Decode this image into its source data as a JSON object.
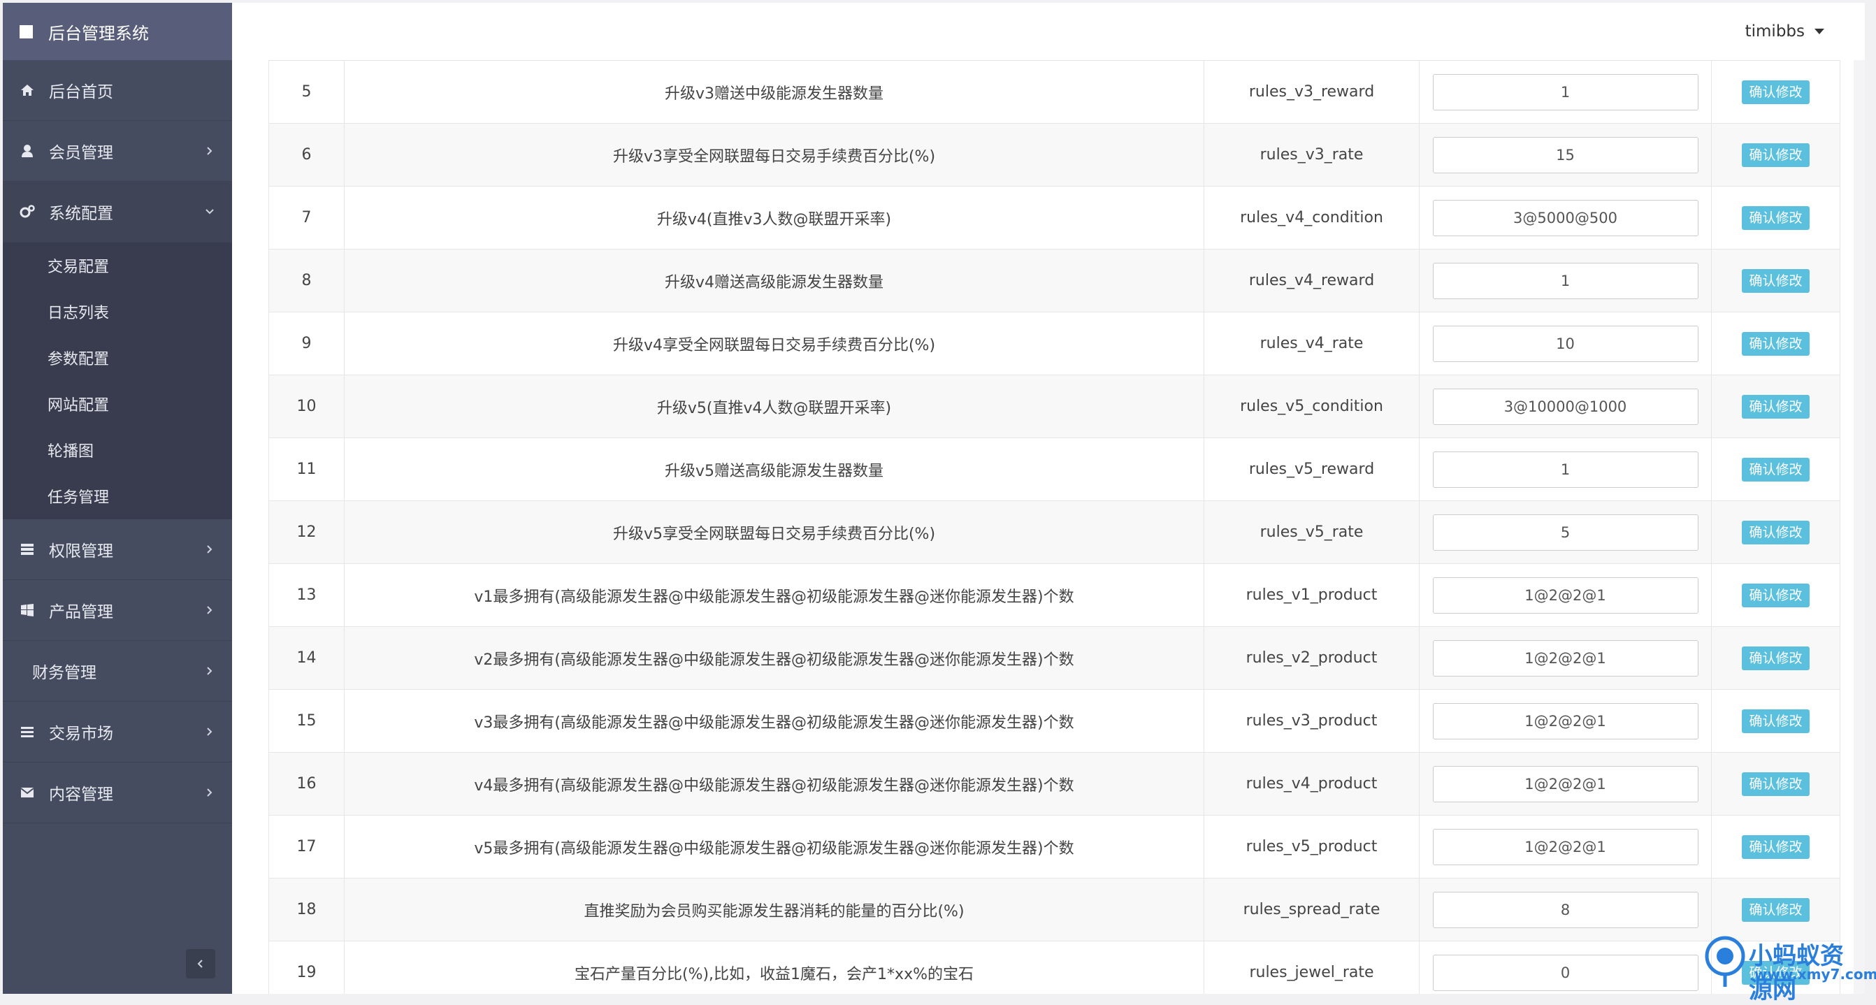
{
  "app": {
    "title": "后台管理系统"
  },
  "header": {
    "user": "timibbs"
  },
  "sidebar": {
    "items": [
      {
        "label": "后台首页",
        "icon": "home-icon",
        "arrow": false
      },
      {
        "label": "会员管理",
        "icon": "user-icon",
        "arrow": true
      },
      {
        "label": "系统配置",
        "icon": "gears-icon",
        "arrow": true,
        "open": true
      },
      {
        "label": "权限管理",
        "icon": "server-icon",
        "arrow": true
      },
      {
        "label": "产品管理",
        "icon": "windows-icon",
        "arrow": true
      },
      {
        "label": "财务管理",
        "icon": "",
        "arrow": true
      },
      {
        "label": "交易市场",
        "icon": "list-icon",
        "arrow": true
      },
      {
        "label": "内容管理",
        "icon": "envelope-icon",
        "arrow": true
      }
    ],
    "submenu": [
      "交易配置",
      "日志列表",
      "参数配置",
      "网站配置",
      "轮播图",
      "任务管理"
    ]
  },
  "table": {
    "button_label": "确认修改",
    "rows": [
      {
        "id": "5",
        "desc": "升级v3赠送中级能源发生器数量",
        "key": "rules_v3_reward",
        "value": "1"
      },
      {
        "id": "6",
        "desc": "升级v3享受全网联盟每日交易手续费百分比(%)",
        "key": "rules_v3_rate",
        "value": "15"
      },
      {
        "id": "7",
        "desc": "升级v4(直推v3人数@联盟开采率)",
        "key": "rules_v4_condition",
        "value": "3@5000@500"
      },
      {
        "id": "8",
        "desc": "升级v4赠送高级能源发生器数量",
        "key": "rules_v4_reward",
        "value": "1"
      },
      {
        "id": "9",
        "desc": "升级v4享受全网联盟每日交易手续费百分比(%)",
        "key": "rules_v4_rate",
        "value": "10"
      },
      {
        "id": "10",
        "desc": "升级v5(直推v4人数@联盟开采率)",
        "key": "rules_v5_condition",
        "value": "3@10000@1000"
      },
      {
        "id": "11",
        "desc": "升级v5赠送高级能源发生器数量",
        "key": "rules_v5_reward",
        "value": "1"
      },
      {
        "id": "12",
        "desc": "升级v5享受全网联盟每日交易手续费百分比(%)",
        "key": "rules_v5_rate",
        "value": "5"
      },
      {
        "id": "13",
        "desc": "v1最多拥有(高级能源发生器@中级能源发生器@初级能源发生器@迷你能源发生器)个数",
        "key": "rules_v1_product",
        "value": "1@2@2@1"
      },
      {
        "id": "14",
        "desc": "v2最多拥有(高级能源发生器@中级能源发生器@初级能源发生器@迷你能源发生器)个数",
        "key": "rules_v2_product",
        "value": "1@2@2@1"
      },
      {
        "id": "15",
        "desc": "v3最多拥有(高级能源发生器@中级能源发生器@初级能源发生器@迷你能源发生器)个数",
        "key": "rules_v3_product",
        "value": "1@2@2@1"
      },
      {
        "id": "16",
        "desc": "v4最多拥有(高级能源发生器@中级能源发生器@初级能源发生器@迷你能源发生器)个数",
        "key": "rules_v4_product",
        "value": "1@2@2@1"
      },
      {
        "id": "17",
        "desc": "v5最多拥有(高级能源发生器@中级能源发生器@初级能源发生器@迷你能源发生器)个数",
        "key": "rules_v5_product",
        "value": "1@2@2@1"
      },
      {
        "id": "18",
        "desc": "直推奖励为会员购买能源发生器消耗的能量的百分比(%)",
        "key": "rules_spread_rate",
        "value": "8"
      },
      {
        "id": "19",
        "desc": "宝石产量百分比(%),比如，收益1魔石，会产1*xx%的宝石",
        "key": "rules_jewel_rate",
        "value": "0"
      }
    ]
  },
  "watermark": {
    "line1": "小蚂蚁资源网",
    "line2": "www.xmy7.com"
  },
  "colors": {
    "sidebar": "#464c60",
    "brand": "#585e7a",
    "button": "#5bc0de",
    "watermark": "#2a7fdc"
  }
}
